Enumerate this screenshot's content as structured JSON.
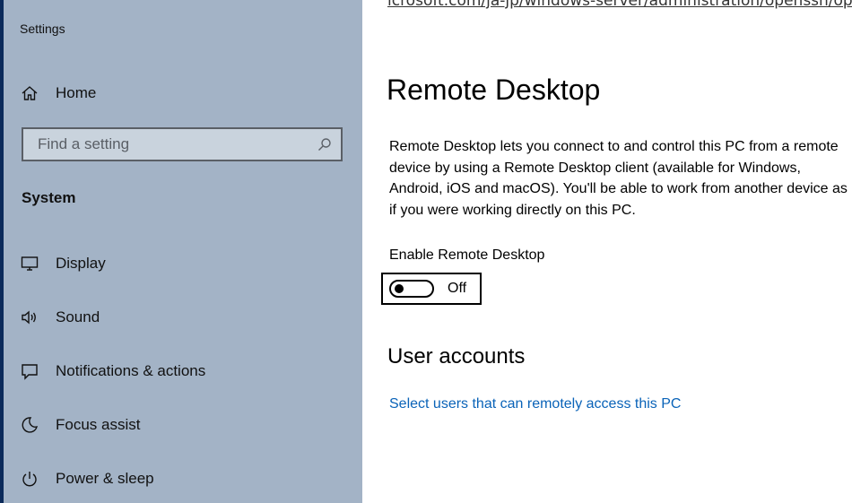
{
  "background_browser": {
    "url_fragment": "icrosoft.com/ja-jp/windows-server/administration/openssh/openssh"
  },
  "app": {
    "title": "Settings"
  },
  "sidebar": {
    "home_label": "Home",
    "search": {
      "placeholder": "Find a setting",
      "value": ""
    },
    "section_heading": "System",
    "items": [
      {
        "label": "Display",
        "icon": "display-icon"
      },
      {
        "label": "Sound",
        "icon": "sound-icon"
      },
      {
        "label": "Notifications & actions",
        "icon": "notifications-icon"
      },
      {
        "label": "Focus assist",
        "icon": "focus-assist-icon"
      },
      {
        "label": "Power & sleep",
        "icon": "power-icon"
      }
    ]
  },
  "main": {
    "title": "Remote Desktop",
    "description_lines": [
      "Remote Desktop lets you connect to and control this PC from a remote",
      "device by using a Remote Desktop client (available for Windows,",
      "Android, iOS and macOS). You'll be able to work from another device as",
      "if you were working directly on this PC."
    ],
    "toggle": {
      "label": "Enable Remote Desktop",
      "state": "Off"
    },
    "user_accounts": {
      "heading": "User accounts",
      "link": "Select users that can remotely access this PC"
    }
  },
  "colors": {
    "sidebar_bg": "#a3b3c6",
    "link": "#0a63b8",
    "desktop": "#0b2a5a"
  }
}
